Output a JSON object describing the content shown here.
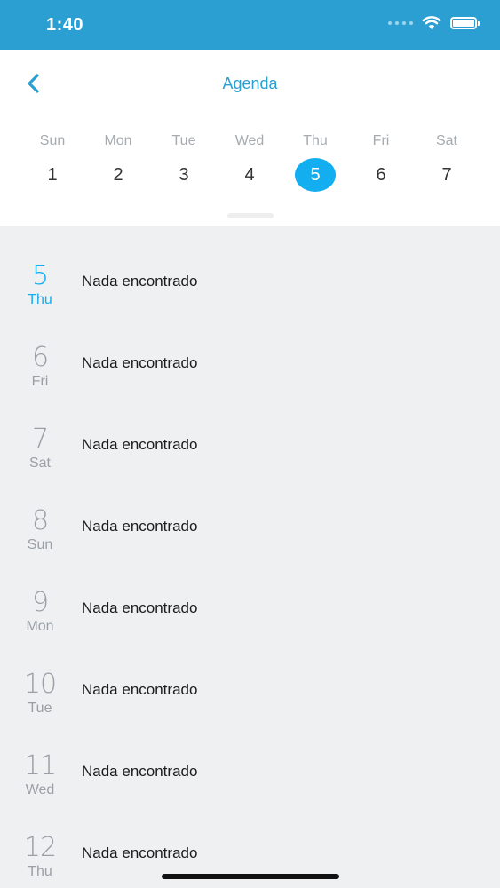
{
  "status_bar": {
    "time": "1:40"
  },
  "header": {
    "title": "Agenda",
    "back_icon": "chevron-left-icon"
  },
  "week": {
    "days": [
      {
        "name": "Sun",
        "num": "1"
      },
      {
        "name": "Mon",
        "num": "2"
      },
      {
        "name": "Tue",
        "num": "3"
      },
      {
        "name": "Wed",
        "num": "4"
      },
      {
        "name": "Thu",
        "num": "5"
      },
      {
        "name": "Fri",
        "num": "6"
      },
      {
        "name": "Sat",
        "num": "7"
      }
    ],
    "selected_index": 4
  },
  "agenda": {
    "rows": [
      {
        "num": "5",
        "day": "Thu",
        "text": "Nada encontrado"
      },
      {
        "num": "6",
        "day": "Fri",
        "text": "Nada encontrado"
      },
      {
        "num": "7",
        "day": "Sat",
        "text": "Nada encontrado"
      },
      {
        "num": "8",
        "day": "Sun",
        "text": "Nada encontrado"
      },
      {
        "num": "9",
        "day": "Mon",
        "text": "Nada encontrado"
      },
      {
        "num": "10",
        "day": "Tue",
        "text": "Nada encontrado"
      },
      {
        "num": "11",
        "day": "Wed",
        "text": "Nada encontrado"
      },
      {
        "num": "12",
        "day": "Thu",
        "text": "Nada encontrado"
      }
    ]
  },
  "colors": {
    "accent": "#13aef0",
    "status_bar": "#2b9fd1",
    "title": "#2b9fd1",
    "muted": "#9aa0a6",
    "background": "#eef0f2"
  }
}
